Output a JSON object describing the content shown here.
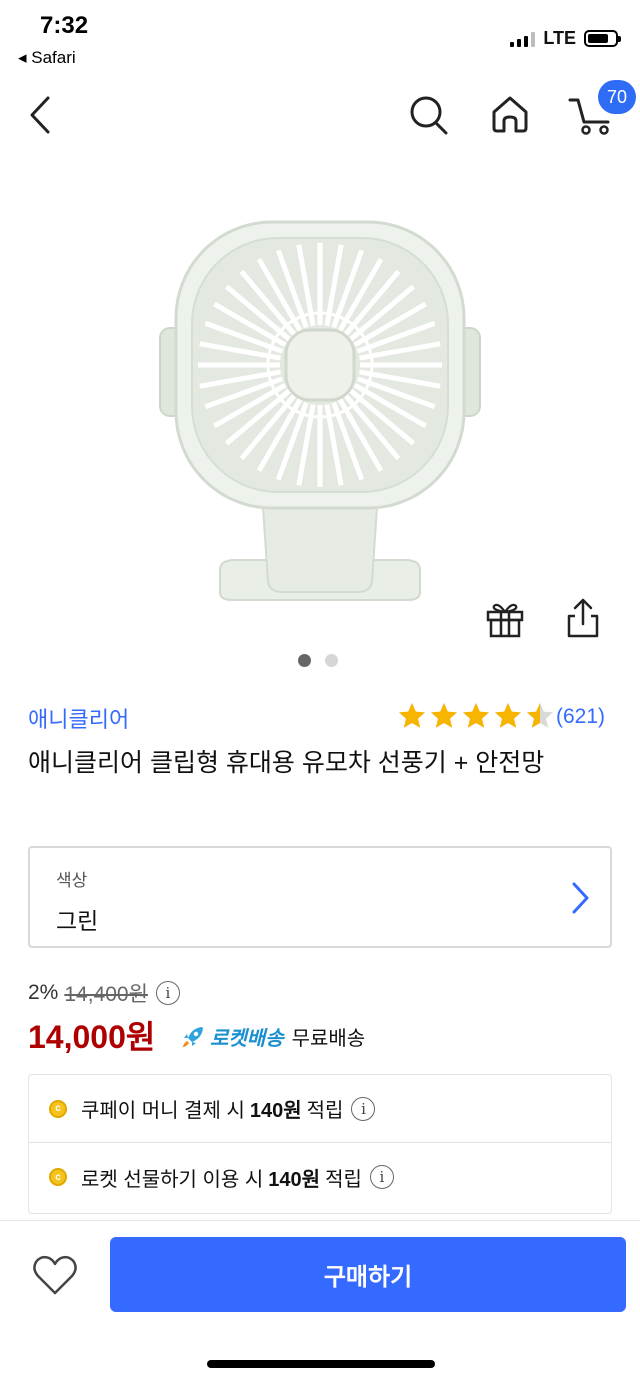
{
  "status_bar": {
    "time": "7:32",
    "back_app": "Safari",
    "network": "LTE"
  },
  "nav": {
    "back_icon": "chevron-left-icon",
    "search_icon": "search-icon",
    "home_icon": "home-icon",
    "cart_icon": "cart-icon",
    "cart_count": "70"
  },
  "product": {
    "image_icon": "clip-fan-image",
    "image_page": 1,
    "image_pages": 2,
    "brand": "애니클리어",
    "rating": 4.5,
    "rating_count": "(621)",
    "title": "애니클리어 클립형 휴대용 유모차 선풍기 + 안전망"
  },
  "option": {
    "label": "색상",
    "value": "그린"
  },
  "pricing": {
    "discount": "2%",
    "original_price": "14,400원",
    "price": "14,000원",
    "rocket_label": "로켓배송",
    "shipping": "무료배송"
  },
  "benefits": [
    {
      "before": "쿠페이 머니 결제 시",
      "amount": "140원",
      "after": "적립"
    },
    {
      "before": "로켓 선물하기 이용 시",
      "amount": "140원",
      "after": "적립"
    }
  ],
  "bottom": {
    "buy_label": "구매하기"
  },
  "colors": {
    "accent_blue": "#346aff",
    "price_red": "#ae0000",
    "star": "#f7b500",
    "rocket_blue": "#1a8fd0"
  }
}
